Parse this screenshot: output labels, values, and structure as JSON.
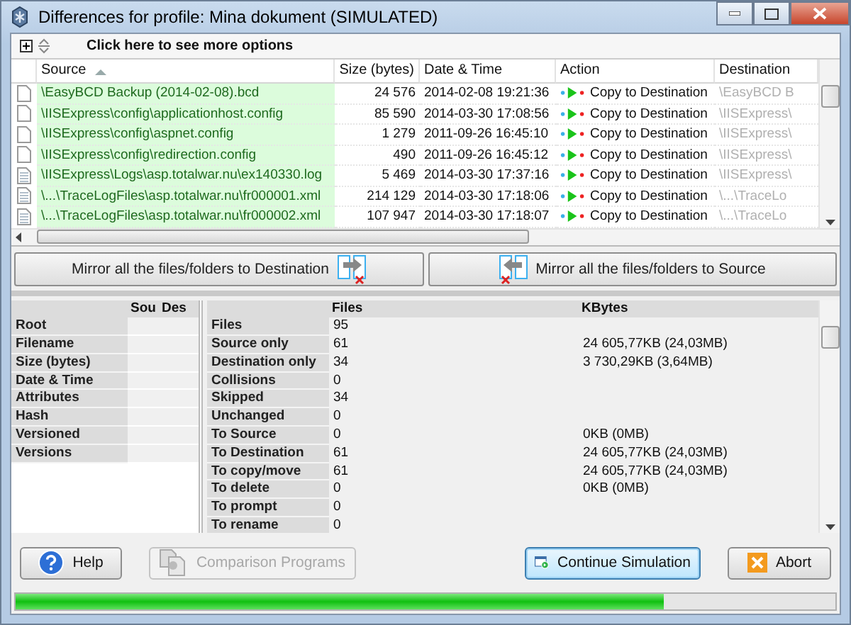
{
  "window": {
    "title": "Differences for profile: Mina dokument (SIMULATED)"
  },
  "options_bar": {
    "label": "Click here to see more options"
  },
  "file_table": {
    "columns": [
      {
        "label": "Source",
        "sorted": true
      },
      {
        "label": "Size (bytes)",
        "sorted": false
      },
      {
        "label": "Date & Time",
        "sorted": false
      },
      {
        "label": "Action",
        "sorted": false
      },
      {
        "label": "Destination",
        "sorted": false
      }
    ],
    "rows": [
      {
        "kind": "blank",
        "source": "\\EasyBCD Backup (2014-02-08).bcd",
        "size": "24 576",
        "date": "2014-02-08 19:21:36",
        "action": "Copy to Destination",
        "destination": "\\EasyBCD B"
      },
      {
        "kind": "blank",
        "source": "\\IISExpress\\config\\applicationhost.config",
        "size": "85 590",
        "date": "2014-03-30 17:08:56",
        "action": "Copy to Destination",
        "destination": "\\IISExpress\\"
      },
      {
        "kind": "blank",
        "source": "\\IISExpress\\config\\aspnet.config",
        "size": "1 279",
        "date": "2011-09-26 16:45:10",
        "action": "Copy to Destination",
        "destination": "\\IISExpress\\"
      },
      {
        "kind": "blank",
        "source": "\\IISExpress\\config\\redirection.config",
        "size": "490",
        "date": "2011-09-26 16:45:12",
        "action": "Copy to Destination",
        "destination": "\\IISExpress\\"
      },
      {
        "kind": "text",
        "source": "\\IISExpress\\Logs\\asp.totalwar.nu\\ex140330.log",
        "size": "5 469",
        "date": "2014-03-30 17:37:16",
        "action": "Copy to Destination",
        "destination": "\\IISExpress\\"
      },
      {
        "kind": "text",
        "source": "\\...\\TraceLogFiles\\asp.totalwar.nu\\fr000001.xml",
        "size": "214 129",
        "date": "2014-03-30 17:18:06",
        "action": "Copy to Destination",
        "destination": "\\...\\TraceLo"
      },
      {
        "kind": "text",
        "source": "\\...\\TraceLogFiles\\asp.totalwar.nu\\fr000002.xml",
        "size": "107 947",
        "date": "2014-03-30 17:18:07",
        "action": "Copy to Destination",
        "destination": "\\...\\TraceLo"
      }
    ]
  },
  "mirror_buttons": [
    {
      "kind": "to_destination",
      "label": "Mirror all the files/folders to Destination"
    },
    {
      "kind": "to_source",
      "label": "Mirror all the files/folders to Source"
    }
  ],
  "compare_panel": {
    "columns": [
      "Sou",
      "Des"
    ],
    "rows": [
      "Root",
      "Filename",
      "Size (bytes)",
      "Date & Time",
      "Attributes",
      "Hash",
      "Versioned",
      "Versions"
    ]
  },
  "stats_panel": {
    "columns": [
      "Files",
      "KBytes"
    ],
    "rows": [
      {
        "label": "Files",
        "files": "95",
        "kbytes": ""
      },
      {
        "label": "Source only",
        "files": "61",
        "kbytes": "24 605,77KB (24,03MB)"
      },
      {
        "label": "Destination only",
        "files": "34",
        "kbytes": "3 730,29KB (3,64MB)"
      },
      {
        "label": "Collisions",
        "files": "0",
        "kbytes": ""
      },
      {
        "label": "Skipped",
        "files": "34",
        "kbytes": ""
      },
      {
        "label": "Unchanged",
        "files": "0",
        "kbytes": ""
      },
      {
        "label": "To Source",
        "files": "0",
        "kbytes": "0KB (0MB)"
      },
      {
        "label": "To Destination",
        "files": "61",
        "kbytes": "24 605,77KB (24,03MB)"
      },
      {
        "label": "To copy/move",
        "files": "61",
        "kbytes": "24 605,77KB (24,03MB)"
      },
      {
        "label": "To delete",
        "files": "0",
        "kbytes": "0KB (0MB)"
      },
      {
        "label": "To prompt",
        "files": "0",
        "kbytes": ""
      },
      {
        "label": "To rename",
        "files": "0",
        "kbytes": ""
      }
    ]
  },
  "buttons": [
    {
      "kind": "help",
      "label": "Help",
      "disabled": false,
      "default": false
    },
    {
      "kind": "compare",
      "label": "Comparison Programs",
      "disabled": true,
      "default": false
    },
    {
      "kind": "continue",
      "label": "Continue Simulation",
      "disabled": false,
      "default": true
    },
    {
      "kind": "abort",
      "label": "Abort",
      "disabled": false,
      "default": false
    }
  ],
  "progress": {
    "level": 0.79
  }
}
